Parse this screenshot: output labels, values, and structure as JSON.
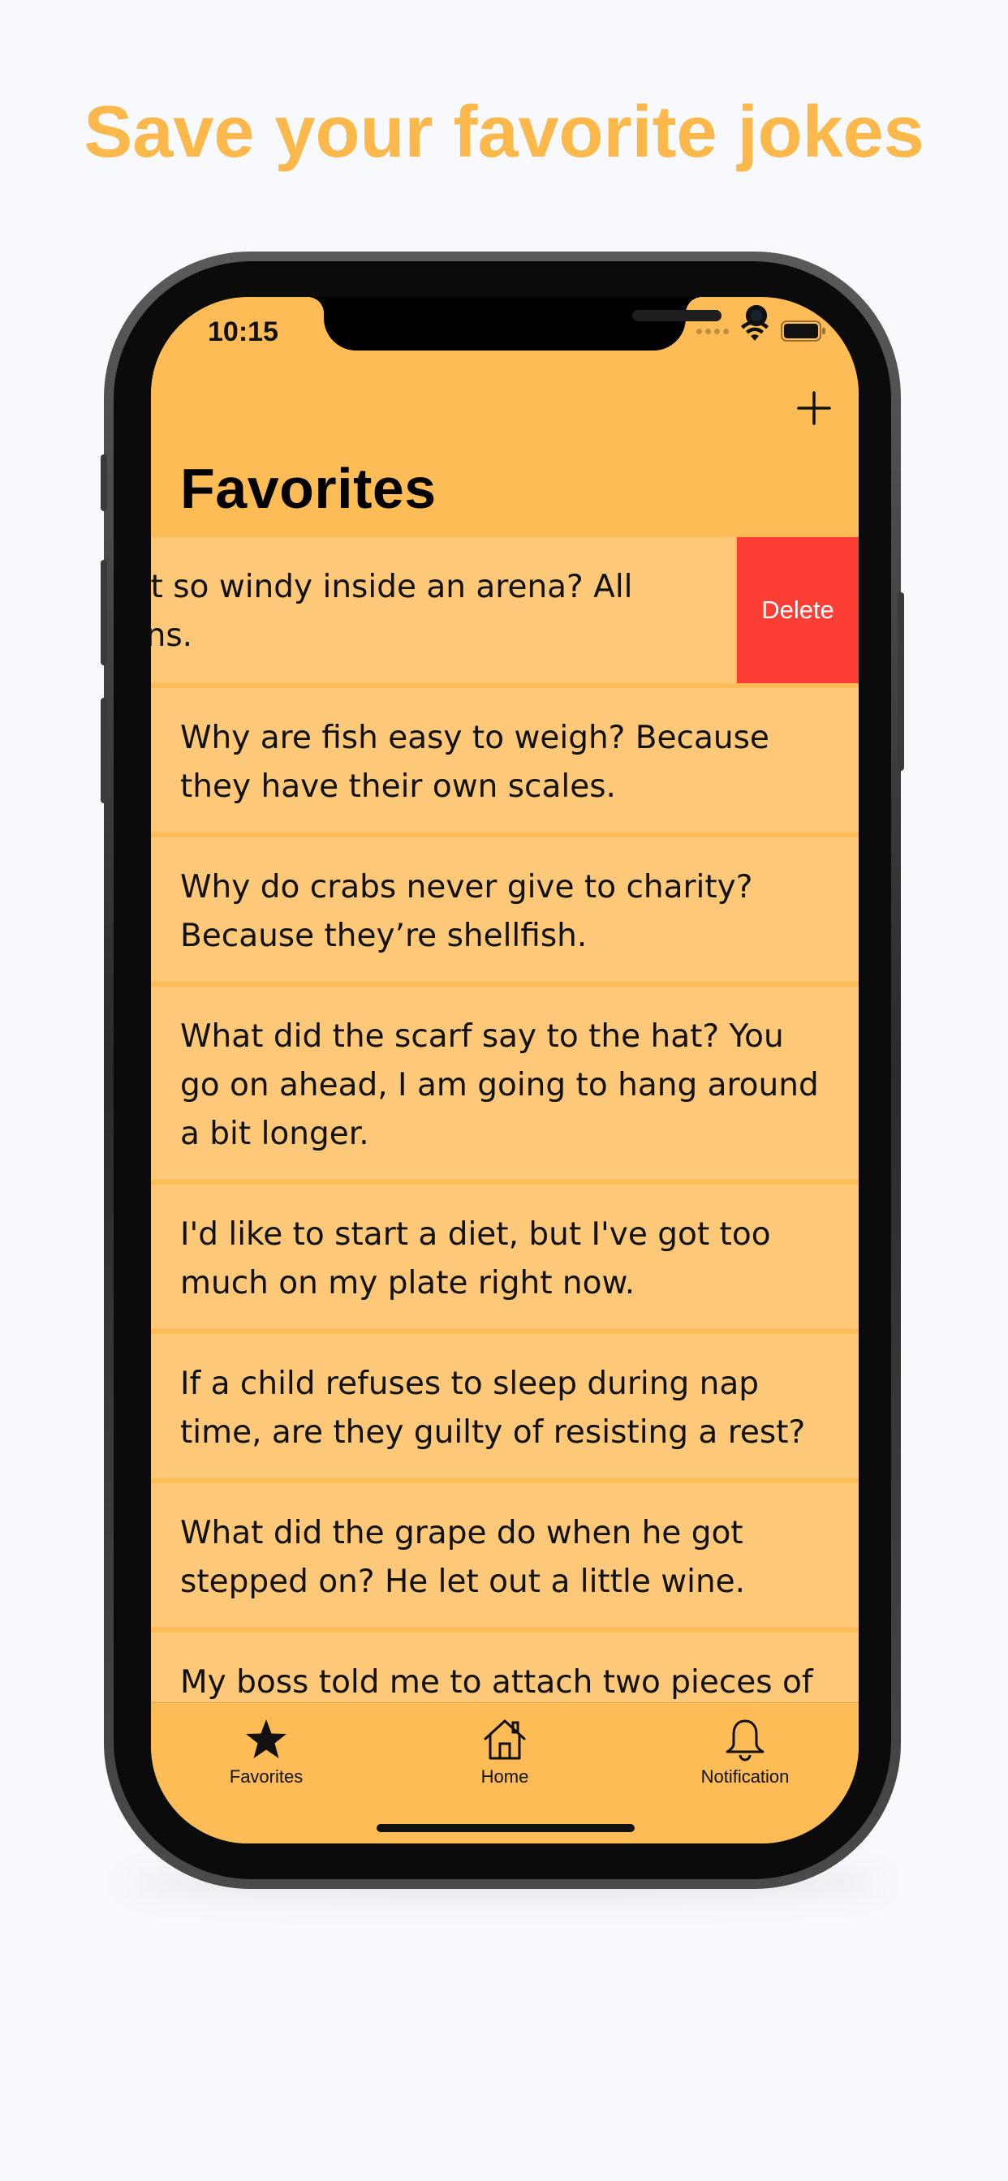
{
  "headline": "Save your favorite jokes",
  "status_bar": {
    "time": "10:15"
  },
  "nav": {
    "title": "Favorites",
    "add_icon": "plus-icon"
  },
  "swiped_row": {
    "text_line_1": "s it so windy inside an arena? All",
    "text_line_2": "fans.",
    "delete_label": "Delete"
  },
  "jokes": [
    {
      "line_1": "Why are fish easy to weigh? Because",
      "line_2": "they have their own scales.",
      "line_3": ""
    },
    {
      "line_1": "Why do crabs never give to charity?",
      "line_2": "Because they’re shellfish.",
      "line_3": ""
    },
    {
      "line_1": "What did the scarf say to the hat? You",
      "line_2": "go on ahead, I am going to hang around",
      "line_3": "a bit longer."
    },
    {
      "line_1": "I'd like to start a diet, but I've got too",
      "line_2": "much on my plate right now.",
      "line_3": ""
    },
    {
      "line_1": "If a child refuses to sleep during nap",
      "line_2": "time, are they guilty of resisting a rest?",
      "line_3": ""
    },
    {
      "line_1": "What did the grape do when he got",
      "line_2": "stepped on? He let out a little wine.",
      "line_3": ""
    },
    {
      "line_1": "My boss told me to attach two pieces of",
      "line_2": "",
      "line_3": ""
    }
  ],
  "tabs": [
    {
      "label": "Favorites",
      "icon": "star-icon"
    },
    {
      "label": "Home",
      "icon": "home-icon"
    },
    {
      "label": "Notification",
      "icon": "bell-icon"
    }
  ],
  "colors": {
    "accent": "#fcb84a",
    "screen_background": "#fdbc55",
    "row_background": "#fec879",
    "delete": "#fc3e35",
    "page_background": "#f7f9fd"
  }
}
